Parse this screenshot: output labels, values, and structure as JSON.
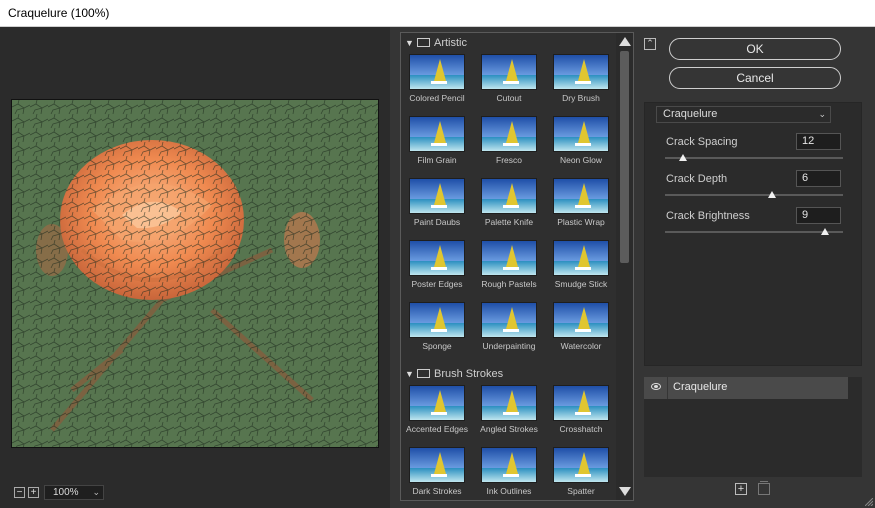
{
  "window": {
    "title": "Craquelure (100%)"
  },
  "preview": {
    "zoom_level": "100%",
    "zoom_out_symbol": "−",
    "zoom_in_symbol": "+"
  },
  "gallery": {
    "categories": [
      {
        "name": "Artistic",
        "items": [
          "Colored Pencil",
          "Cutout",
          "Dry Brush",
          "Film Grain",
          "Fresco",
          "Neon Glow",
          "Paint Daubs",
          "Palette Knife",
          "Plastic Wrap",
          "Poster Edges",
          "Rough Pastels",
          "Smudge Stick",
          "Sponge",
          "Underpainting",
          "Watercolor"
        ]
      },
      {
        "name": "Brush Strokes",
        "items": [
          "Accented Edges",
          "Angled Strokes",
          "Crosshatch",
          "Dark Strokes",
          "Ink Outlines",
          "Spatter"
        ]
      }
    ]
  },
  "actions": {
    "ok_label": "OK",
    "cancel_label": "Cancel",
    "collapse_icon": "collapse-up-icon"
  },
  "settings": {
    "filter_name": "Craquelure",
    "params": [
      {
        "label": "Crack Spacing",
        "value": "12",
        "fraction": 0.1
      },
      {
        "label": "Crack Depth",
        "value": "6",
        "fraction": 0.6
      },
      {
        "label": "Crack Brightness",
        "value": "9",
        "fraction": 0.9
      }
    ]
  },
  "layers": {
    "items": [
      {
        "name": "Craquelure",
        "visible": true
      }
    ],
    "new_layer_symbol": "+"
  },
  "colors": {
    "background": "#353535",
    "panel": "#2b2b2b",
    "selected_layer": "#4a4a4a",
    "rose": "#f08a50",
    "foliage": "#4e6b48"
  }
}
